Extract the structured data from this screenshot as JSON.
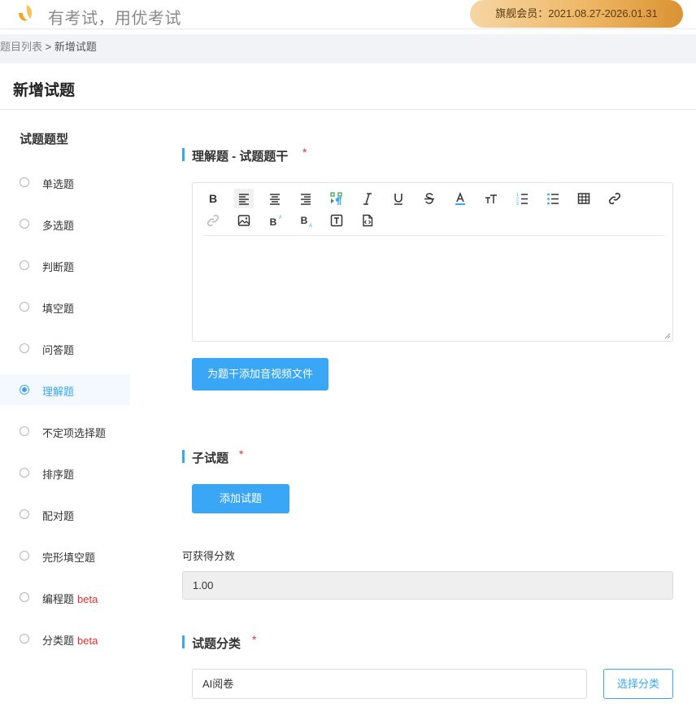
{
  "header": {
    "brand": "有考试，用优考试",
    "member_badge": "旗舰会员：2021.08.27-2026.01.31",
    "logo_icon": "leaf-logo-icon"
  },
  "breadcrumb": {
    "parent": "题目列表",
    "separator": " > ",
    "current": "新增试题"
  },
  "page": {
    "title": "新增试题"
  },
  "sidebar": {
    "heading": "试题题型",
    "items": [
      {
        "label": "单选题",
        "beta": "",
        "selected": false
      },
      {
        "label": "多选题",
        "beta": "",
        "selected": false
      },
      {
        "label": "判断题",
        "beta": "",
        "selected": false
      },
      {
        "label": "填空题",
        "beta": "",
        "selected": false
      },
      {
        "label": "问答题",
        "beta": "",
        "selected": false
      },
      {
        "label": "理解题",
        "beta": "",
        "selected": true
      },
      {
        "label": "不定项选择题",
        "beta": "",
        "selected": false
      },
      {
        "label": "排序题",
        "beta": "",
        "selected": false
      },
      {
        "label": "配对题",
        "beta": "",
        "selected": false
      },
      {
        "label": "完形填空题",
        "beta": "",
        "selected": false
      },
      {
        "label": "编程题",
        "beta": "beta",
        "selected": false
      },
      {
        "label": "分类题",
        "beta": "beta",
        "selected": false
      }
    ]
  },
  "stem": {
    "heading": "理解题 - 试题题干",
    "required_mark": "*",
    "editor_value": "",
    "media_button": "为题干添加音视频文件",
    "toolbar_icons": [
      "bold-icon",
      "align-left-icon",
      "align-center-icon",
      "align-right-icon",
      "paragraph-icon",
      "italic-icon",
      "underline-icon",
      "strikethrough-icon",
      "font-color-icon",
      "font-size-icon",
      "ordered-list-icon",
      "unordered-list-icon",
      "table-icon",
      "link-icon",
      "unlink-icon",
      "image-icon",
      "superscript-icon",
      "subscript-icon",
      "text-box-icon",
      "code-file-icon"
    ]
  },
  "sub_questions": {
    "heading": "子试题",
    "required_mark": "*",
    "add_button": "添加试题"
  },
  "score": {
    "label": "可获得分数",
    "value": "1.00"
  },
  "category": {
    "heading": "试题分类",
    "required_mark": "*",
    "value": "AI阅卷",
    "select_button": "选择分类"
  },
  "colors": {
    "accent": "#3aa7f6",
    "required": "#e8302a",
    "member_gradient_start": "#f6d6a4",
    "member_gradient_end": "#db9233"
  }
}
